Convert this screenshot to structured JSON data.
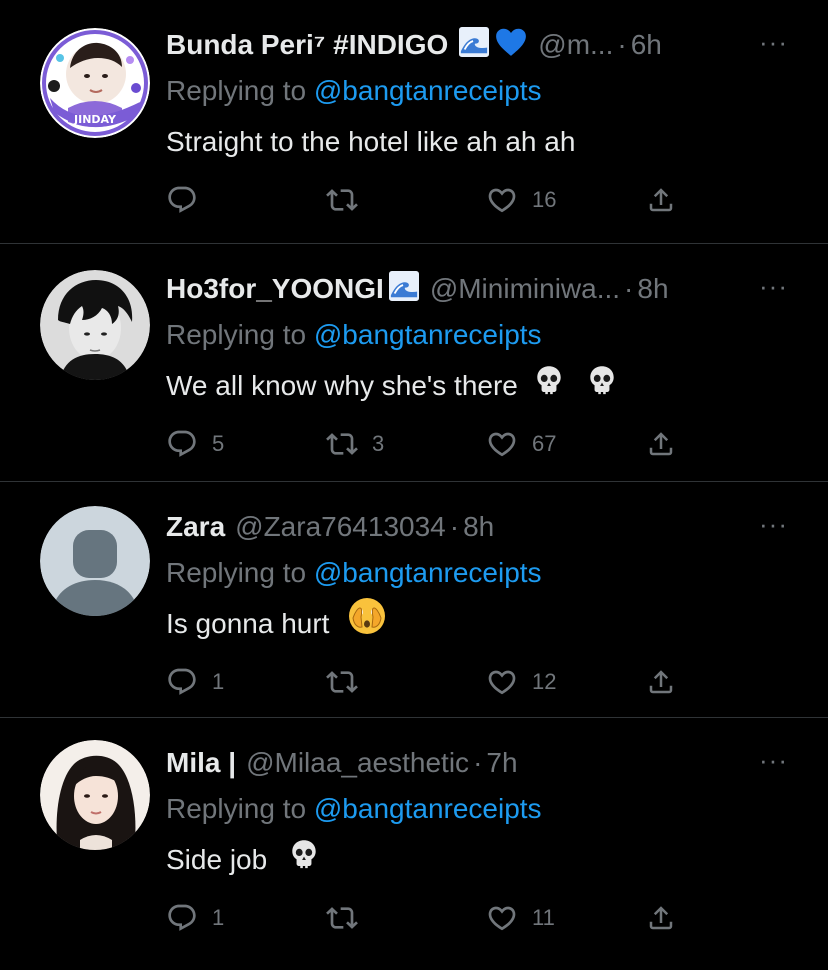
{
  "tweets": [
    {
      "name": "Bunda Peri⁷ #INDIGO",
      "emojis": [
        "wave-emoji",
        "blue-heart-emoji"
      ],
      "handle": "@m...",
      "sep": "·",
      "time": "6h",
      "replying_prefix": "Replying to ",
      "replying_to": "@bangtanreceipts",
      "text": "Straight to the hotel like ah ah ah",
      "text_emojis": [],
      "replies": "",
      "retweets": "",
      "likes": "16",
      "avatar": "jinday-badge-avatar",
      "avatar_text": "JINDAY"
    },
    {
      "name": "Ho3for_YOONGI",
      "emojis": [
        "wave-emoji"
      ],
      "handle": "@Miniminiwa...",
      "sep": "·",
      "time": "8h",
      "replying_prefix": "Replying to ",
      "replying_to": "@bangtanreceipts",
      "text": "We all know why she's there",
      "text_emojis": [
        "skull-emoji",
        "skull-emoji"
      ],
      "replies": "5",
      "retweets": "3",
      "likes": "67",
      "avatar": "bw-portrait-avatar"
    },
    {
      "name": "Zara",
      "emojis": [],
      "handle": "@Zara76413034",
      "sep": "·",
      "time": "8h",
      "replying_prefix": "Replying to ",
      "replying_to": "@bangtanreceipts",
      "text": "Is gonna hurt",
      "text_emojis": [
        "face-peeking-emoji"
      ],
      "replies": "1",
      "retweets": "",
      "likes": "12",
      "avatar": "default-avatar"
    },
    {
      "name": "Mila |",
      "emojis": [],
      "handle": "@Milaa_aesthetic",
      "sep": "·",
      "time": "7h",
      "replying_prefix": "Replying to ",
      "replying_to": "@bangtanreceipts",
      "text": "Side job",
      "text_emojis": [
        "skull-emoji"
      ],
      "replies": "1",
      "retweets": "",
      "likes": "11",
      "avatar": "portrait-avatar"
    }
  ],
  "more_label": "···",
  "colors": {
    "background": "#000000",
    "text": "#e7e9ea",
    "muted": "#71767b",
    "link": "#1d9bf0",
    "divider": "#2f3336"
  }
}
